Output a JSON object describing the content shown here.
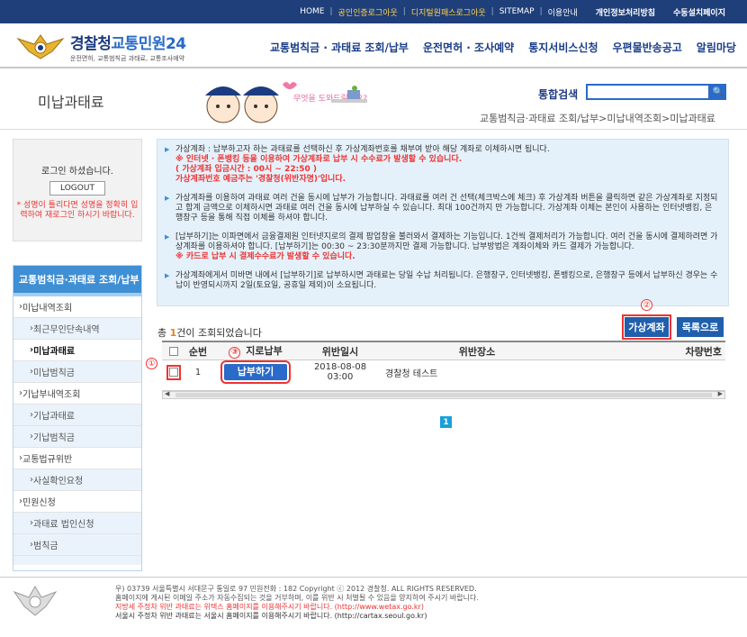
{
  "topnav": {
    "items": [
      {
        "label": "HOME",
        "style": "normal"
      },
      {
        "label": "공인인증로그아웃",
        "style": "yellow"
      },
      {
        "label": "디지털원패스로그아웃",
        "style": "yellow"
      },
      {
        "label": "SITEMAP",
        "style": "normal"
      },
      {
        "label": "이용안내",
        "style": "normal"
      },
      {
        "label": "개인정보처리방침",
        "style": "bold"
      },
      {
        "label": "수동설치페이지",
        "style": "bold"
      }
    ]
  },
  "logo": {
    "title_main": "경찰청",
    "title_blue": "교통민원24",
    "subtitle": "운전면허, 교통범칙금 과태료, 교통조사예약"
  },
  "gnb": [
    "교통범칙금 · 과태료 조회/납부",
    "운전면허 · 조사예약",
    "통지서비스신청",
    "우편물반송공고",
    "알림마당"
  ],
  "page": {
    "title": "미납과태료",
    "mascot_text": "무엇을 도와드릴까요?",
    "search_label": "통합검색",
    "breadcrumb": "교통범칙금·과태료 조회/납부>미납내역조회>미납과태료"
  },
  "login": {
    "msg": "로그인 하셨습니다.",
    "logout": "LOGOUT",
    "warn": "* 성명이 틀리다면 성명을 정확히 입력하여 재로그인 하시기 바랍니다."
  },
  "sidemenu": {
    "head": "교통범칙금·과태료 조회/납부",
    "items": [
      {
        "label": "미납내역조회",
        "type": "grp"
      },
      {
        "label": "최근무인단속내역",
        "type": "sub"
      },
      {
        "label": "미납과태료",
        "type": "sub on"
      },
      {
        "label": "미납범칙금",
        "type": "sub"
      },
      {
        "label": "기납부내역조회",
        "type": "grp"
      },
      {
        "label": "기납과태료",
        "type": "sub"
      },
      {
        "label": "기납범칙금",
        "type": "sub"
      },
      {
        "label": "교통법규위반",
        "type": "grp"
      },
      {
        "label": "사실확인요청",
        "type": "sub"
      },
      {
        "label": "민원신청",
        "type": "grp"
      },
      {
        "label": "과태료 법인신청",
        "type": "sub"
      },
      {
        "label": "범칙금",
        "type": "sub"
      }
    ]
  },
  "notice": {
    "p1": "가상계좌 : 납부하고자 하는 과태료를 선택하신 후 가상계좌번호를 채부여 받아 해당 계좌로 이체하시면 됩니다.",
    "p1_red1": "※ 인터넷 · 폰뱅킹 등을 이용하여 가상계좌로 납부 시 수수료가 발생할 수 있습니다.",
    "p1_red2": "( 가상계좌 입금시간 : 00시 ~ 22:50 )",
    "p1_red3": "가상계좌번호 예금주는 '경찰청(위반자명)'입니다.",
    "p2": "가상계좌를 이용하여 과태료 여러 건을 동시에 납부가 가능합니다. 과태료를 여러 건 선택(체크박스에 체크) 후 가상계좌 버튼을 클릭하면 같은 가상계좌로 지정되고 합계 금액으로 이체하시면 과태료 여러 건을 동시에 납부하실 수 있습니다. 최대 100건까지 만 가능합니다. 가상계좌 이체는 본인이 사용하는 인터넷뱅킹, 은행창구 등을 통해 직접 이체를 하셔야 합니다.",
    "p3": "[납부하기]는 이파면에서 금융결제원 인터넷지로의 결제 팝업창을 불러와서 결제하는 기능입니다. 1건씩 결제처리가 가능합니다. 여러 건을 동시에 결제하려면 가상계좌를 이용하셔야 합니다. [납부하기]는 00:30 ~ 23:30분까지만 결제 가능합니다. 납부방법은 계좌이체와 카드 결제가 가능합니다.",
    "p3_red": "※ 카드로 납부 시 결제수수료가 발생할 수 있습니다.",
    "p4": "가상계좌에게서 미바면 내에서 [납부하기]로 납부하시면 과태료는 당일 수납 처리됩니다. 은행창구, 인터넷뱅킹, 폰뱅킹으로, 은행창구 등에서 납부하신 경우는 수납이 반영되시까지 2일(토요일, 공휴일 제외)이 소요됩니다."
  },
  "result": {
    "count_prefix": "총 ",
    "count_num": "1",
    "count_suffix": "건이 조회되었습니다",
    "btn_va": "가상계좌",
    "btn_list": "목록으로"
  },
  "annotations": {
    "a1": "①",
    "a2": "②",
    "a3": "③"
  },
  "table": {
    "headers": [
      "순번",
      "지로납부",
      "위반일시",
      "위반장소",
      "차량번호"
    ],
    "rows": [
      {
        "no": "1",
        "pay": "납부하기",
        "date": "2018-08-08 03:00",
        "place": "경찰청 테스트",
        "car": ""
      }
    ]
  },
  "pager": {
    "current": "1"
  },
  "footer": {
    "l1": "우) 03739 서울특별시 서대문구 통일로 97 민원전화 : 182    Copyright ⓒ 2012 경찰청. ALL RIGHTS RESERVED.",
    "l2": "홈페이지에 게시된 이메일 주소가 자동수집되는 것을 거부하며, 이를 위반 시 처벌될 수 있음을 양지하여 주시기 바랍니다.",
    "l3": "지방세 주정차 위반 과태료는 위택스 홈페이지를 이용해주시기 바랍니다. (http://www.wetax.go.kr)",
    "l4": "서울시 주정차 위반 과태료는 서울시 홈페이지를 이용해주시기 바랍니다. (http://cartax.seoul.go.kr)"
  },
  "colors": {
    "navy": "#1f3f7a",
    "blue": "#2a6ac8",
    "red": "#e33"
  }
}
